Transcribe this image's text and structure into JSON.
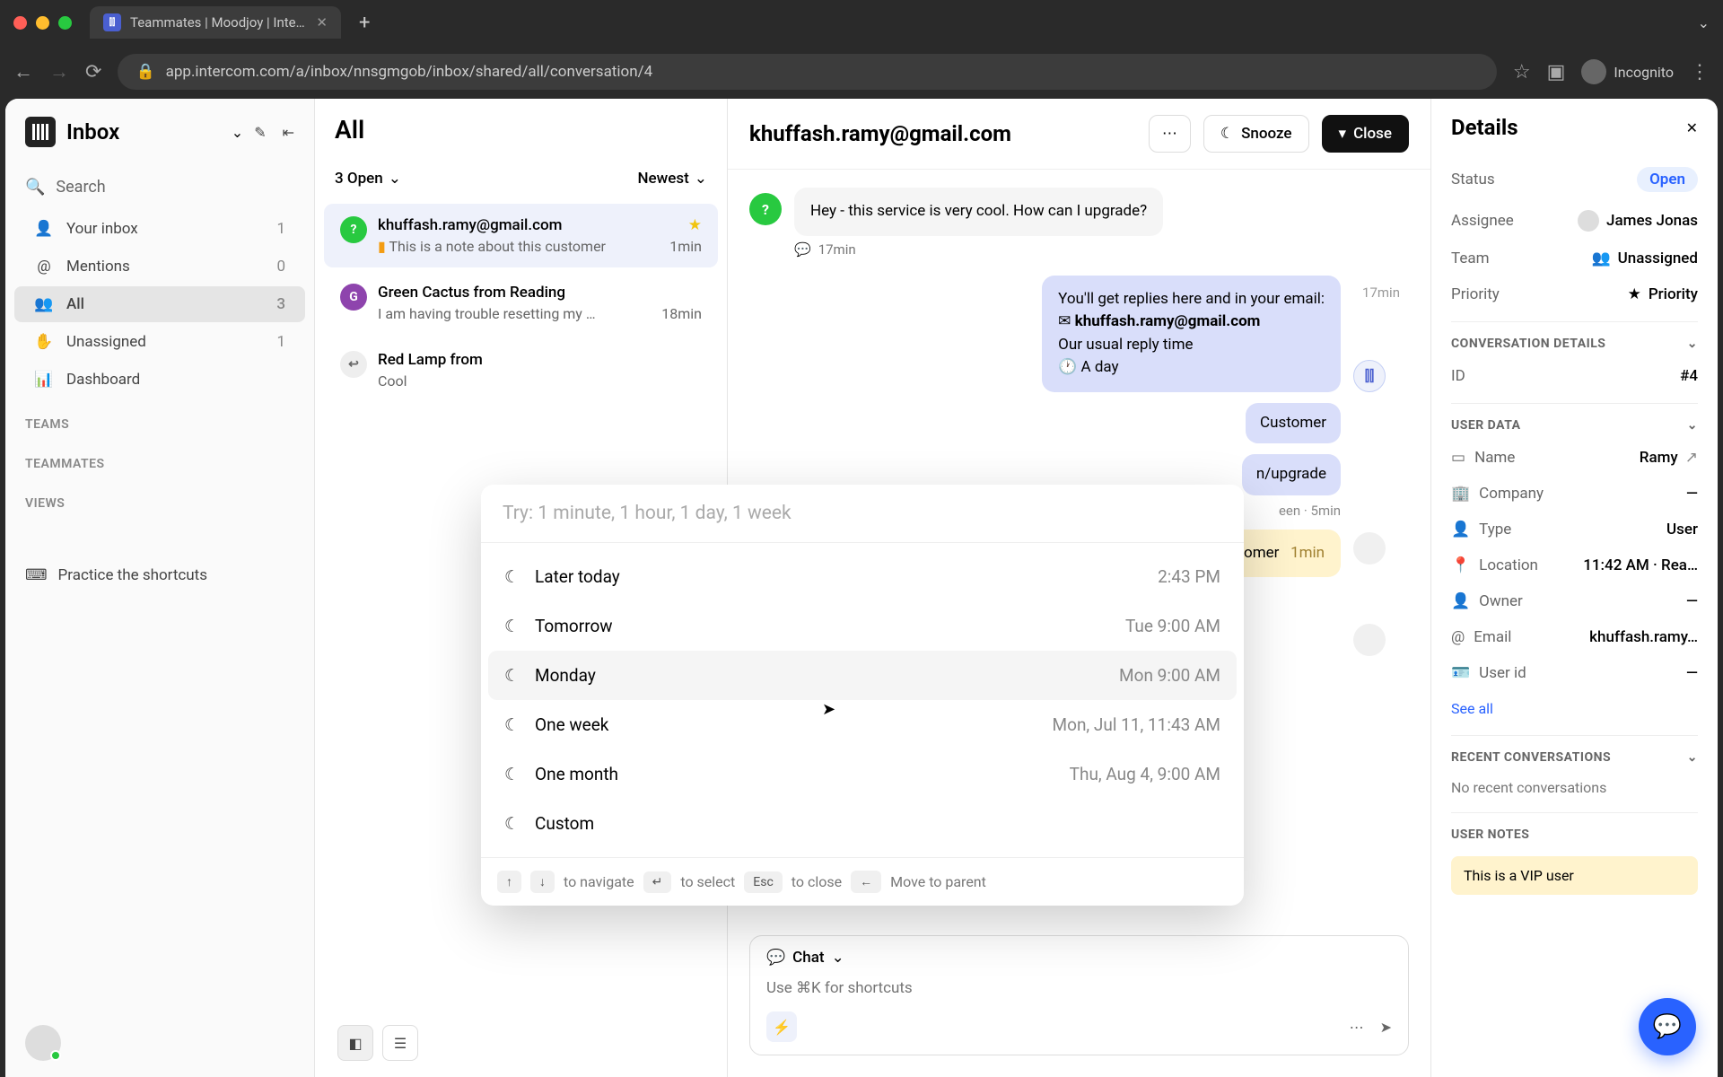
{
  "browser": {
    "tab_title": "Teammates | Moodjoy | Intercom",
    "url": "app.intercom.com/a/inbox/nnsgmgob/inbox/shared/all/conversation/4",
    "incognito_label": "Incognito"
  },
  "sidebar": {
    "title": "Inbox",
    "search": "Search",
    "items": [
      {
        "icon": "user-icon",
        "label": "Your inbox",
        "count": "1"
      },
      {
        "icon": "at-icon",
        "label": "Mentions",
        "count": "0"
      },
      {
        "icon": "people-icon",
        "label": "All",
        "count": "3",
        "active": true
      },
      {
        "icon": "hand-icon",
        "label": "Unassigned",
        "count": "1"
      },
      {
        "icon": "chart-icon",
        "label": "Dashboard",
        "count": ""
      }
    ],
    "section_teams": "TEAMS",
    "section_teammates": "TEAMMATES",
    "section_views": "VIEWS",
    "shortcuts": "Practice the shortcuts"
  },
  "conv_list": {
    "title": "All",
    "filter_open": "3 Open",
    "filter_sort": "Newest",
    "items": [
      {
        "avatar": "?",
        "avatar_class": "green",
        "from": "khuffash.ramy@gmail.com",
        "starred": true,
        "preview": "This is a note about this customer",
        "note": true,
        "time": "1min",
        "selected": true
      },
      {
        "avatar": "G",
        "avatar_class": "purple",
        "from": "Green Cactus from Reading",
        "preview": "I am having trouble resetting my …",
        "time": "18min"
      },
      {
        "avatar": "↩",
        "avatar_class": "reply",
        "from": "Red Lamp from",
        "preview": "Cool",
        "time": ""
      }
    ]
  },
  "main": {
    "title": "khuffash.ramy@gmail.com",
    "snooze": "Snooze",
    "close": "Close",
    "messages": {
      "incoming_text": "Hey - this service is very cool. How can I upgrade?",
      "incoming_time": "17min",
      "auto_reply_line1": "You'll get replies here and in your email:",
      "auto_reply_email": "khuffash.ramy@gmail.com",
      "auto_reply_line2": "Our usual reply time",
      "auto_reply_line3": "🕐 A day",
      "auto_time": "17min",
      "cust_tag": "Customer",
      "upgrade_link": "n/upgrade",
      "seen": "een · 5min",
      "note_text": "customer",
      "note_time": "1min"
    },
    "composer": {
      "mode": "Chat",
      "placeholder": "Use ⌘K for shortcuts"
    }
  },
  "details": {
    "title": "Details",
    "status_label": "Status",
    "status_value": "Open",
    "assignee_label": "Assignee",
    "assignee_value": "James Jonas",
    "team_label": "Team",
    "team_value": "Unassigned",
    "priority_label": "Priority",
    "priority_value": "Priority",
    "section_conv": "CONVERSATION DETAILS",
    "id_label": "ID",
    "id_value": "#4",
    "section_user": "USER DATA",
    "name_label": "Name",
    "name_value": "Ramy",
    "company_label": "Company",
    "company_value": "—",
    "type_label": "Type",
    "type_value": "User",
    "location_label": "Location",
    "location_value": "11:42 AM · Rea…",
    "owner_label": "Owner",
    "owner_value": "—",
    "email_label": "Email",
    "email_value": "khuffash.ramy…",
    "userid_label": "User id",
    "userid_value": "—",
    "see_all": "See all",
    "section_recent": "RECENT CONVERSATIONS",
    "recent_empty": "No recent conversations",
    "section_notes": "USER NOTES",
    "note_text": "This is a VIP user"
  },
  "snooze": {
    "placeholder": "Try: 1 minute, 1 hour, 1 day, 1 week",
    "items": [
      {
        "label": "Later today",
        "time": "2:43 PM"
      },
      {
        "label": "Tomorrow",
        "time": "Tue 9:00 AM"
      },
      {
        "label": "Monday",
        "time": "Mon 9:00 AM",
        "hover": true
      },
      {
        "label": "One week",
        "time": "Mon, Jul 11, 11:43 AM"
      },
      {
        "label": "One month",
        "time": "Thu, Aug 4, 9:00 AM"
      },
      {
        "label": "Custom",
        "time": ""
      }
    ],
    "hint_nav": "to navigate",
    "hint_select": "to select",
    "hint_close": "to close",
    "hint_close_key": "Esc",
    "hint_parent": "Move to parent"
  }
}
